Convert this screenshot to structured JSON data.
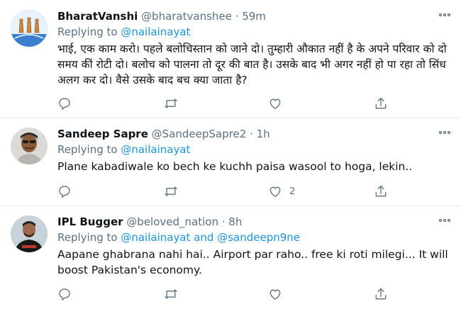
{
  "colors": {
    "accent": "#1b95e0",
    "muted": "#5b7083",
    "border": "#e6ecf0"
  },
  "tweets": [
    {
      "name": "BharatVanshi",
      "handle": "@bharatvanshee",
      "dot": "·",
      "time": "59m",
      "replying_prefix": "Replying to",
      "mentions": [
        "@nailainayat"
      ],
      "text": "भाई, एक काम करो। पहले बलोचिस्तान को जाने दो। तुम्हारी औकात नहीं है के अपने परिवार को दो समय कीं रोटी दो। बलोच को पालना तो दूर की बात है। उसके बाद भी अगर नहीं हो पा रहा तो सिंध अलग कर दो। वैसे उसके बाद बच क्या जाता है?",
      "like_count": ""
    },
    {
      "name": "Sandeep Sapre",
      "handle": "@SandeepSapre2",
      "dot": "·",
      "time": "1h",
      "replying_prefix": "Replying to",
      "mentions": [
        "@nailainayat"
      ],
      "text": "Plane kabadiwale ko bech ke kuchh paisa wasool to hoga, lekin..",
      "like_count": "2"
    },
    {
      "name": "IPL Bugger",
      "handle": "@beloved_nation",
      "dot": "·",
      "time": "8h",
      "replying_prefix": "Replying to",
      "mentions": [
        "@nailainayat",
        "@sandeepn9ne"
      ],
      "and_word": "and",
      "text": "Aapane ghabrana nahi hai.. Airport par raho.. free ki roti milegi... It will boost Pakistan's economy.",
      "like_count": ""
    }
  ],
  "icons": [
    "reply-icon",
    "retweet-icon",
    "like-icon",
    "share-icon",
    "more-icon"
  ]
}
